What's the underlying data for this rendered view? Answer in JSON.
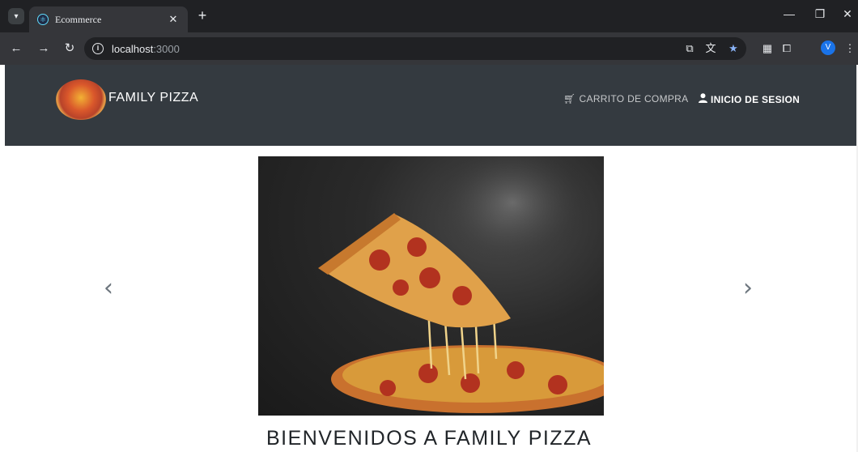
{
  "browser": {
    "tab_title": "Ecommerce",
    "url_host": "localhost",
    "url_port": ":3000",
    "profile_initial": "V"
  },
  "navbar": {
    "brand": "FAMILY PIZZA",
    "cart_label": "CARRITO DE COMPRA",
    "login_label": "INICIO DE SESION"
  },
  "carousel": {
    "prev_glyph": "‹",
    "next_glyph": "›"
  },
  "main": {
    "welcome": "BIENVENIDOS A FAMILY PIZZA"
  },
  "colors": {
    "navbar_bg": "#343a40",
    "chrome_dark": "#202124",
    "chrome_toolbar": "#35363a"
  }
}
